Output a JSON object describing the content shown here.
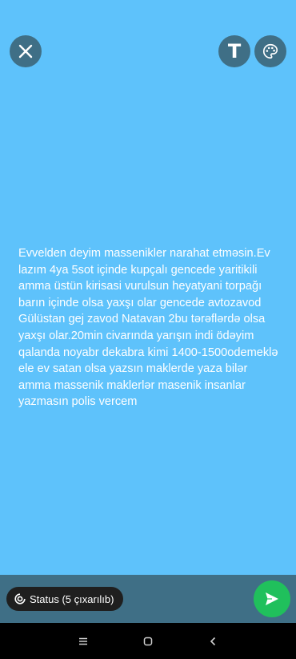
{
  "status_text": "Evvelden deyim massenikler narahat etməsin.Ev lazım 4ya 5sot içinde kupçalı gencede yaritikili amma üstün kirisasi vurulsun heyatyani torpağı barın içinde olsa yaxşı olar gencede avtozavod Gülüstan gej zavod Natavan 2bu tərəflərdə olsa yaxşı olar.20min civarında yarışın indi ödəyim qalanda noyabr dekabra kimi 1400-1500odemeklə ele ev satan olsa yazsın maklerde yaza bilər amma massenik maklerlər masenik insanlar yazmasın polis vercem",
  "top_bar": {
    "close_icon": "close-icon",
    "text_button_label": "T",
    "palette_icon": "palette-icon"
  },
  "bottom_bar": {
    "status_chip_label": "Status (5 çıxarılıb)",
    "status_chip_icon": "status-ring-icon",
    "send_icon": "send-icon"
  },
  "nav_bar": {
    "icons": [
      "menu-icon",
      "home-icon",
      "back-icon"
    ]
  },
  "colors": {
    "canvas_background": "#5ec2fb",
    "bar_background": "#3f6f86",
    "send_button": "#20c05c"
  }
}
